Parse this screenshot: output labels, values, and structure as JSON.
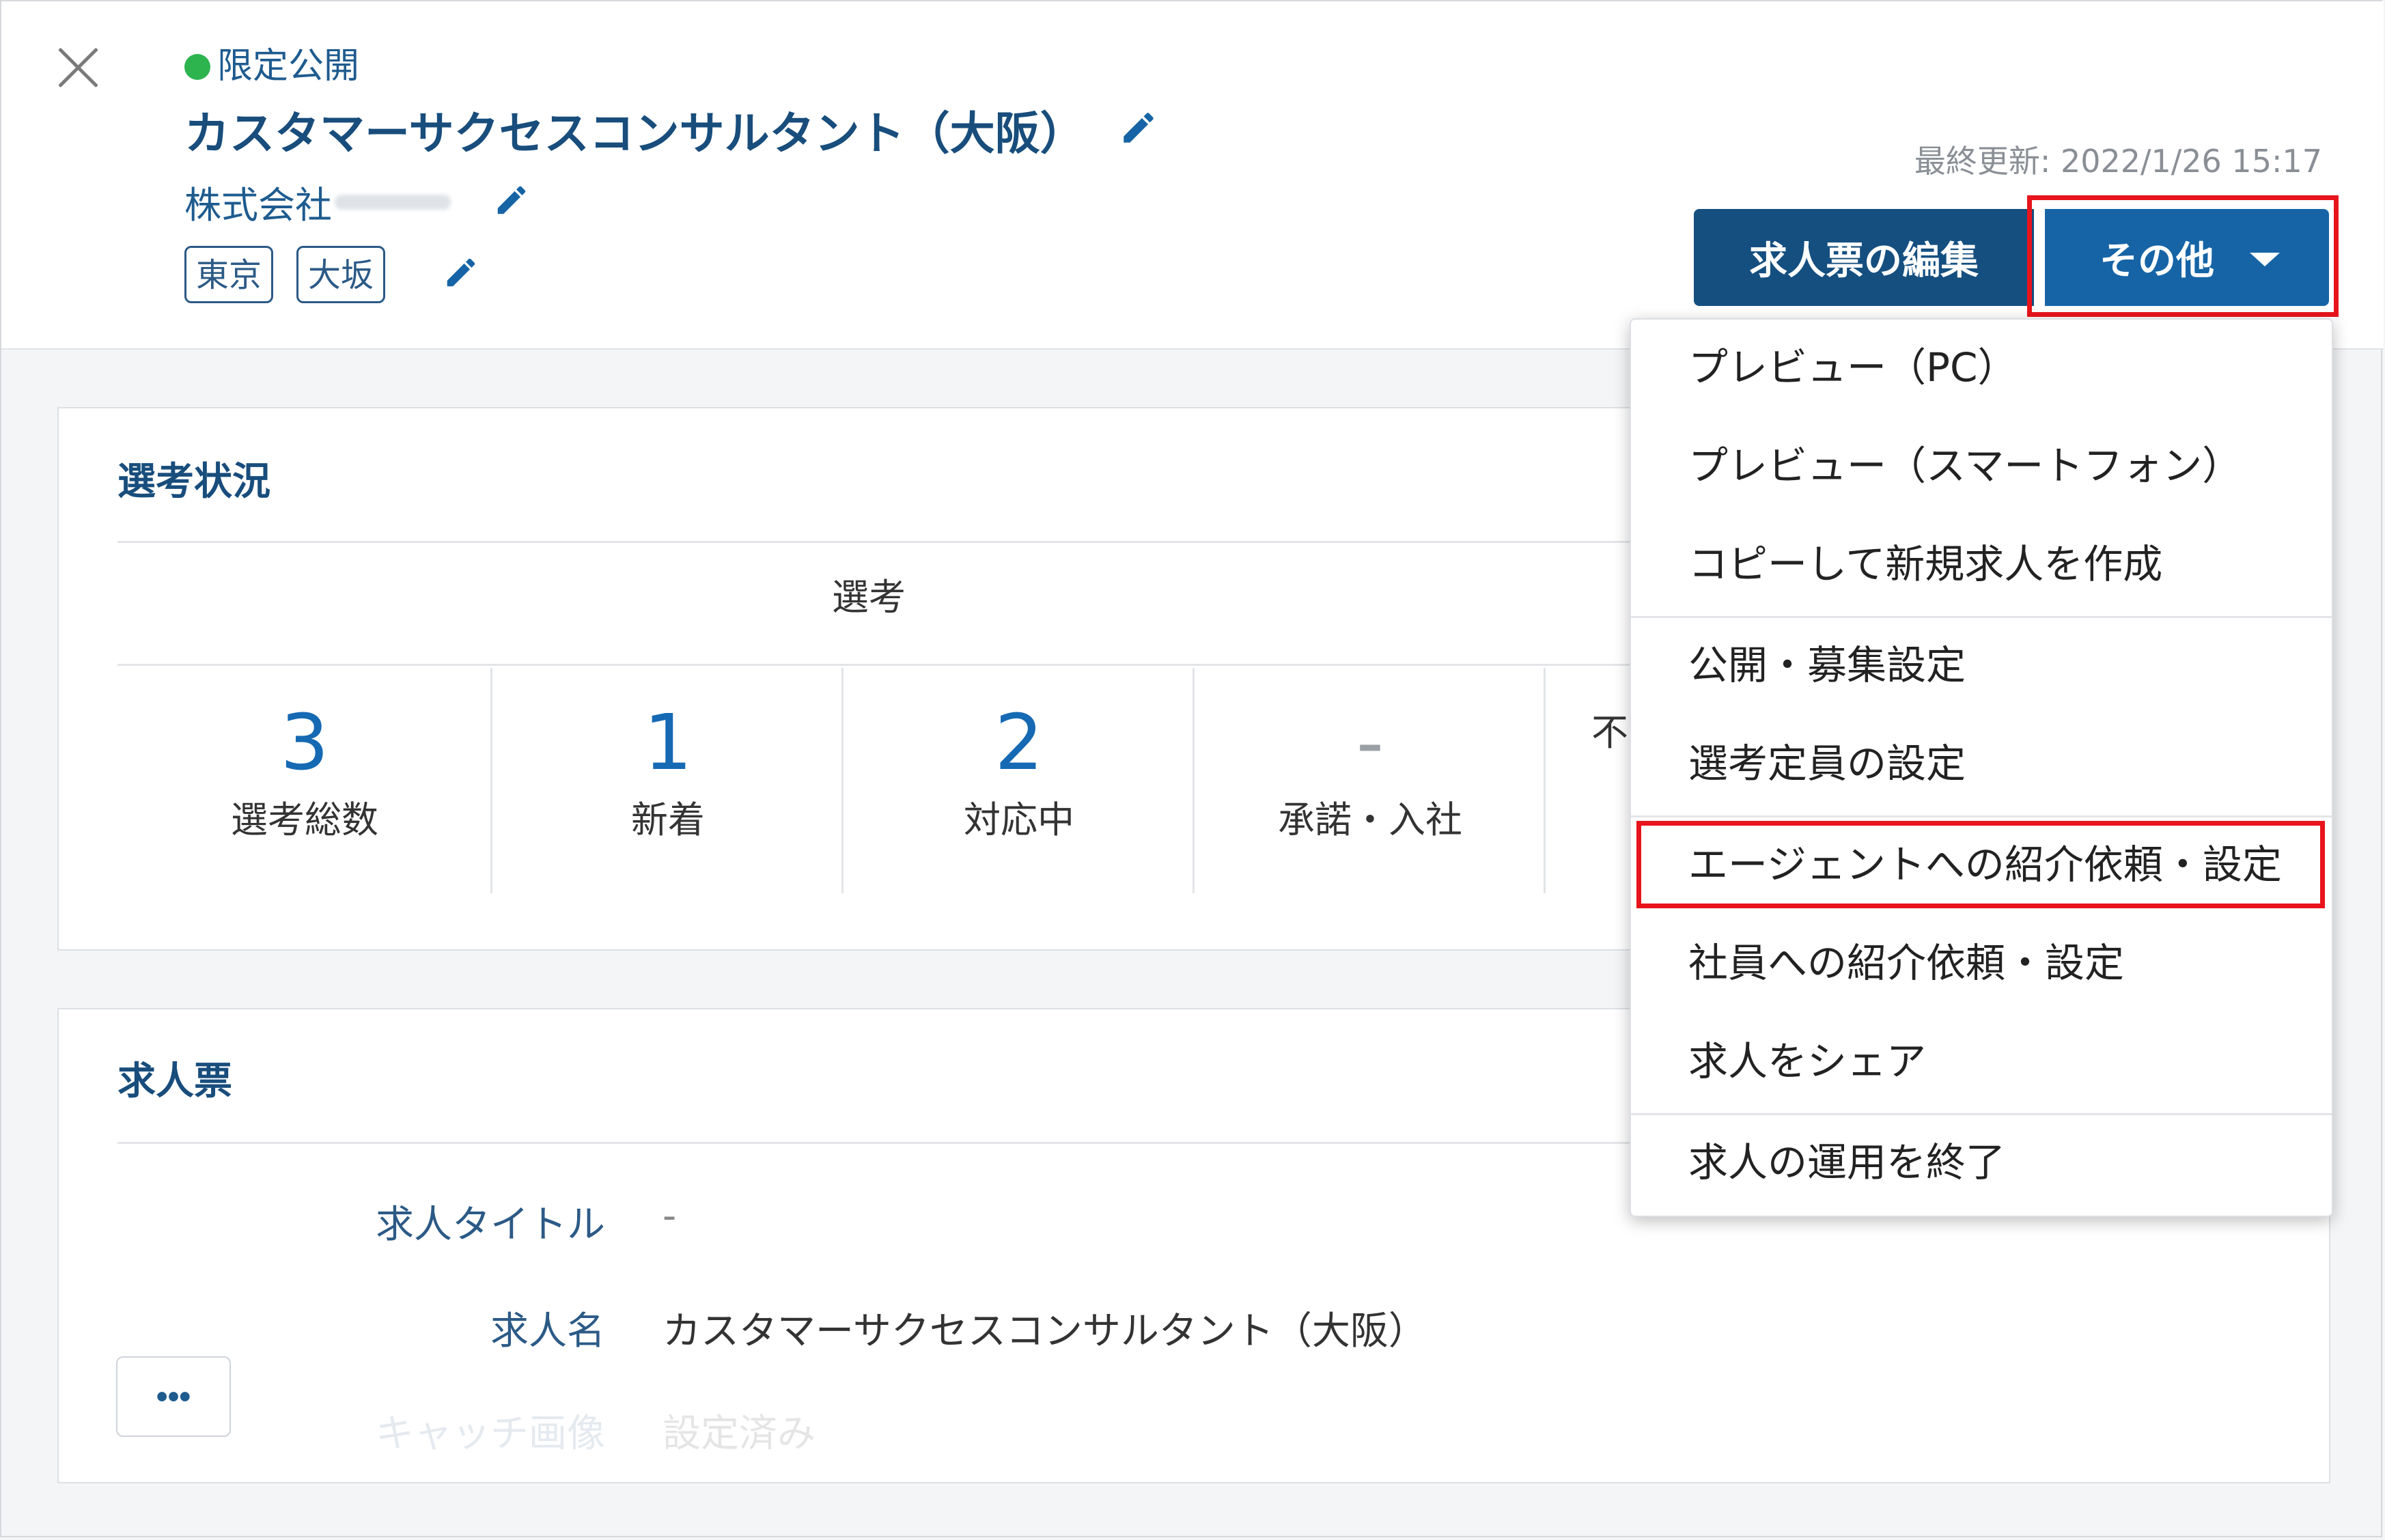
{
  "header": {
    "status": "限定公開",
    "title": "カスタマーサクセスコンサルタント（大阪）",
    "company": "株式会社",
    "tags": [
      "東京",
      "大坂"
    ],
    "updated": "最終更新: 2022/1/26 15:17",
    "edit_button": "求人票の編集",
    "other_button": "その他"
  },
  "selection": {
    "title": "選考状況",
    "group_header": "選考",
    "stats": [
      {
        "value": "3",
        "label": "選考総数"
      },
      {
        "value": "1",
        "label": "新着"
      },
      {
        "value": "2",
        "label": "対応中"
      },
      {
        "value": "-",
        "label": "承諾・入社"
      },
      {
        "value": "",
        "label": "不"
      }
    ]
  },
  "job_card": {
    "title": "求人票",
    "fields": [
      {
        "label": "求人タイトル",
        "value": "-"
      },
      {
        "label": "求人名",
        "value": "カスタマーサクセスコンサルタント（大阪）"
      },
      {
        "label": "キャッチ画像",
        "value": "設定済み"
      }
    ],
    "more_button": "•••"
  },
  "menu": {
    "items": [
      "プレビュー（PC）",
      "プレビュー（スマートフォン）",
      "コピーして新規求人を作成",
      "公開・募集設定",
      "選考定員の設定",
      "エージェントへの紹介依頼・設定",
      "社員への紹介依頼・設定",
      "求人をシェア",
      "求人の運用を終了"
    ]
  },
  "colors": {
    "primary_dark": "#154f80",
    "primary": "#1664a6",
    "highlight": "#e8141c",
    "status_green": "#2db44f"
  }
}
